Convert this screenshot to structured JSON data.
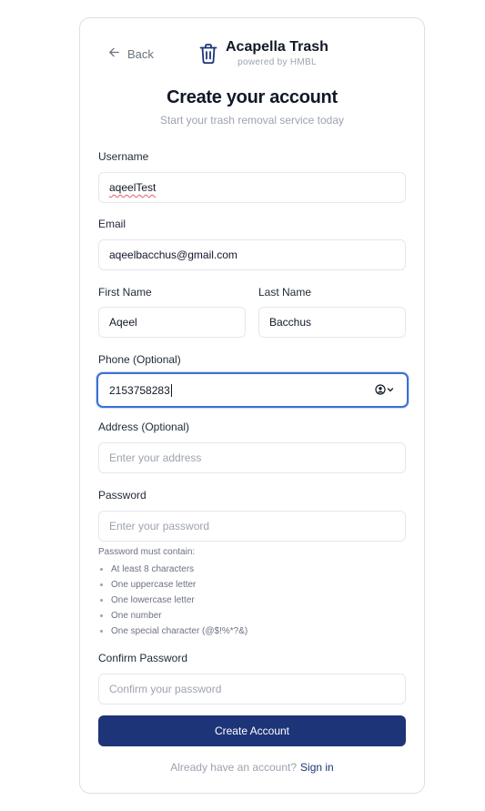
{
  "header": {
    "back_label": "Back",
    "brand_title": "Acapella Trash",
    "brand_subtitle": "powered by HMBL"
  },
  "page": {
    "title": "Create your account",
    "subtitle": "Start your trash removal service today"
  },
  "form": {
    "username": {
      "label": "Username",
      "value": "aqeelTest"
    },
    "email": {
      "label": "Email",
      "value": "aqeelbacchus@gmail.com"
    },
    "first_name": {
      "label": "First Name",
      "value": "Aqeel"
    },
    "last_name": {
      "label": "Last Name",
      "value": "Bacchus"
    },
    "phone": {
      "label": "Phone (Optional)",
      "value": "2153758283"
    },
    "address": {
      "label": "Address (Optional)",
      "placeholder": "Enter your address"
    },
    "password": {
      "label": "Password",
      "placeholder": "Enter your password"
    },
    "password_hint": {
      "title": "Password must contain:",
      "items": [
        "At least 8 characters",
        "One uppercase letter",
        "One lowercase letter",
        "One number",
        "One special character (@$!%*?&)"
      ]
    },
    "confirm_password": {
      "label": "Confirm Password",
      "placeholder": "Confirm your password"
    }
  },
  "actions": {
    "submit_label": "Create Account",
    "footer_text": "Already have an account?",
    "footer_link": "Sign in"
  },
  "colors": {
    "primary": "#1e3478",
    "focus": "#3b6fd6",
    "muted": "#9ca3af"
  }
}
